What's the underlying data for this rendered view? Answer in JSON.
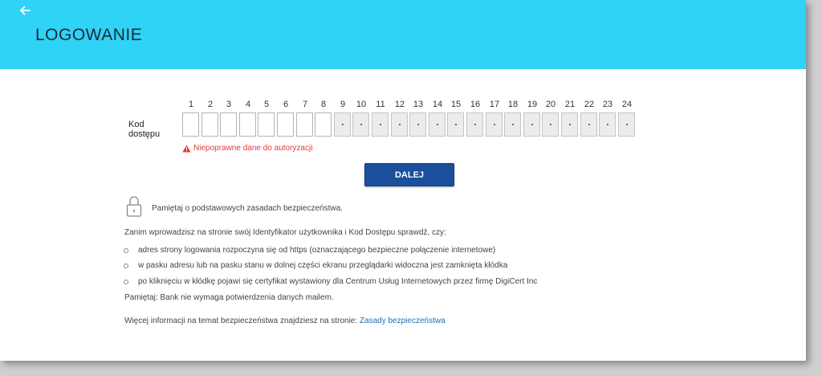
{
  "header": {
    "title": "LOGOWANIE",
    "back_icon": "arrow-left-icon",
    "color": "#2fd3f5"
  },
  "code": {
    "label": "Kod dostępu",
    "positions": [
      "1",
      "2",
      "3",
      "4",
      "5",
      "6",
      "7",
      "8",
      "9",
      "10",
      "11",
      "12",
      "13",
      "14",
      "15",
      "16",
      "17",
      "18",
      "19",
      "20",
      "21",
      "22",
      "23",
      "24"
    ],
    "enabled_positions": [
      1,
      2,
      3,
      4,
      5,
      6,
      7,
      8
    ]
  },
  "error": {
    "text": "Niepoprawne dane do autoryzacji",
    "icon": "warning-triangle-icon",
    "color": "#e53935"
  },
  "next_button": {
    "label": "DALEJ",
    "color": "#1a4f9c"
  },
  "security": {
    "icon": "padlock-icon",
    "heading": "Pamiętaj o podstawowych zasadach bezpieczeństwa.",
    "intro": "Zanim wprowadzisz na stronie swój Identyfikator użytkownika i Kod Dostępu sprawdź, czy:",
    "bullets": [
      "adres strony logowania rozpoczyna się od https (oznaczającego bezpieczne połączenie internetowe)",
      "w pasku adresu lub na pasku stanu w dolnej części ekranu przeglądarki widoczna jest zamknięta kłódka",
      "po kliknięciu w kłódkę pojawi się certyfikat wystawiony dla Centrum Usług Internetowych przez firmę DigiCert Inc"
    ],
    "reminder": "Pamiętaj: Bank nie wymaga potwierdzenia danych mailem.",
    "more_info_text": "Więcej informacji na temat bezpieczeństwa znajdziesz na stronie: ",
    "more_info_link": "Zasady bezpieczeństwa",
    "link_color": "#1f6fb5"
  }
}
